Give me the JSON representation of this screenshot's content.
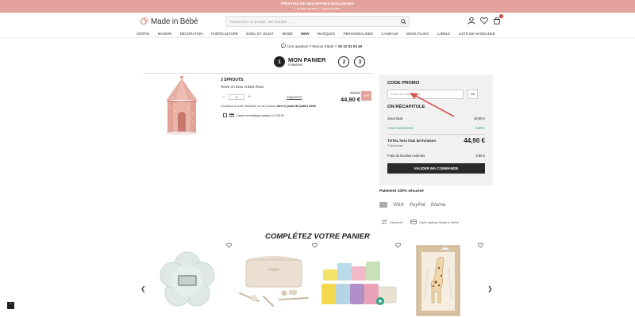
{
  "promo": {
    "line1": "PROFITEZ DE NOS OFFRES EXCLUSIVES",
    "line2": "1 produit acheté = 1 produit offert"
  },
  "header": {
    "logo_text": "Made in Bébé",
    "search_placeholder": "Rechercher un produit, une marque ...",
    "cart_count": "1"
  },
  "nav": {
    "items": [
      "SORTIE",
      "MAISON",
      "DÉCORATION",
      "PUÉRICULTURE",
      "ÉVEIL ET JOUET",
      "MODE",
      "NEW",
      "MARQUES",
      "PERSONNALISER",
      "CADEAUX",
      "BONS PLANS",
      "LABELS",
      "LISTE DE NAISSANCE"
    ]
  },
  "help": {
    "text": "Une question ? Besoin d'aide ?",
    "phone": "05 31 53 03 40"
  },
  "steps": {
    "current_number": "1",
    "current_title": "MON PANIER",
    "cart_number": "N°8885469",
    "step2": "2",
    "step3": "3"
  },
  "product": {
    "brand": "3 SPROUTS",
    "name": "Tente en tissu enfant Rose",
    "qty_minus": "−",
    "qty_value": "1",
    "qty_plus": "+",
    "remove_label": "Supprimer",
    "old_price": "49,90 €",
    "price": "44,90 €",
    "discount": "-10%",
    "delivery_text": "Livraison à votre domicile ou au bureau",
    "delivery_date": "dès le jeudi 30 juillet 2026",
    "gift_option": "Option emballage cadeau (+3,90 €)"
  },
  "summary": {
    "promo_heading": "CODE PROMO",
    "promo_placeholder": "Entrez un code promo",
    "ok_label": "OK",
    "recap_heading": "ON RÉCAPITULE",
    "subtotal_label": "Sous-total",
    "subtotal_value": "49,90 €",
    "savings_label": "Vous économisez",
    "savings_value": "-4,99 €",
    "total_label": "TOTAL hors frais de livraison",
    "total_value": "44,90 €",
    "taxes_label": "TVA incluse",
    "shipping_label": "Frais de livraison estimés",
    "shipping_value": "4,90 €",
    "validate_label": "VALIDER MA COMMANDE"
  },
  "payment": {
    "title": "Paiement 100% sécurisé",
    "methods": [
      "VISA",
      "PayPal",
      "Klarna"
    ],
    "service1": "Virement",
    "service2": "Carte cadeau Made in Bébé"
  },
  "suggestions": {
    "title": "COMPLÉTEZ VOTRE PANIER"
  },
  "colors": {
    "brand_pink": "#e3a29b",
    "dark_button": "#2a2a2a",
    "savings_green": "#3a9d5a",
    "annotation_red": "#d9534f"
  }
}
